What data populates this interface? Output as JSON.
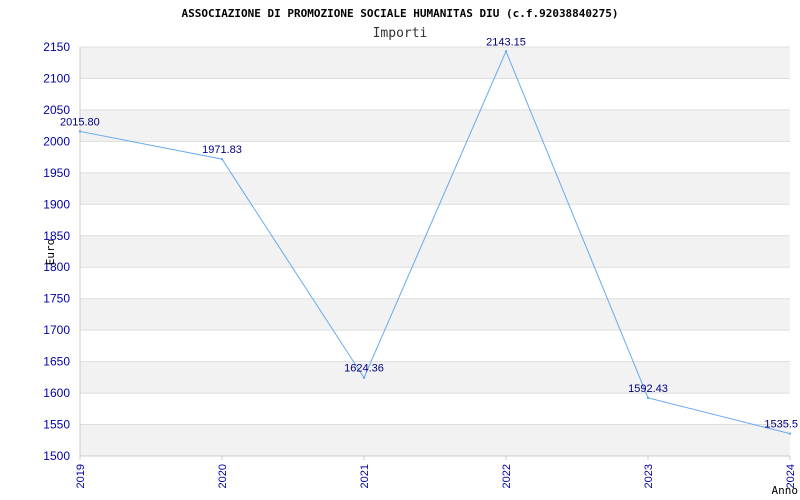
{
  "chart_data": {
    "type": "line",
    "title": "ASSOCIAZIONE DI PROMOZIONE SOCIALE HUMANITAS DIU (c.f.92038840275)",
    "subtitle": "Importi",
    "xlabel": "Anno",
    "ylabel": "Euro",
    "categories": [
      "2019",
      "2020",
      "2021",
      "2022",
      "2023",
      "2024"
    ],
    "series": [
      {
        "values": [
          2015.8,
          1971.83,
          1624.36,
          2143.15,
          1592.43,
          1535.5
        ],
        "labels": [
          "2015.80",
          "1971.83",
          "1624.36",
          "2143.15",
          "1592.43",
          "1535.5"
        ]
      }
    ],
    "ylim": [
      1500,
      2150
    ],
    "yticks": [
      1500,
      1550,
      1600,
      1650,
      1700,
      1750,
      1800,
      1850,
      1900,
      1950,
      2000,
      2050,
      2100,
      2150
    ],
    "grid": true,
    "colors": {
      "line": "#66aaee",
      "band": "#f2f2f2",
      "grid": "#dddddd",
      "tick_text": "#0000aa",
      "data_label": "#000080"
    }
  }
}
